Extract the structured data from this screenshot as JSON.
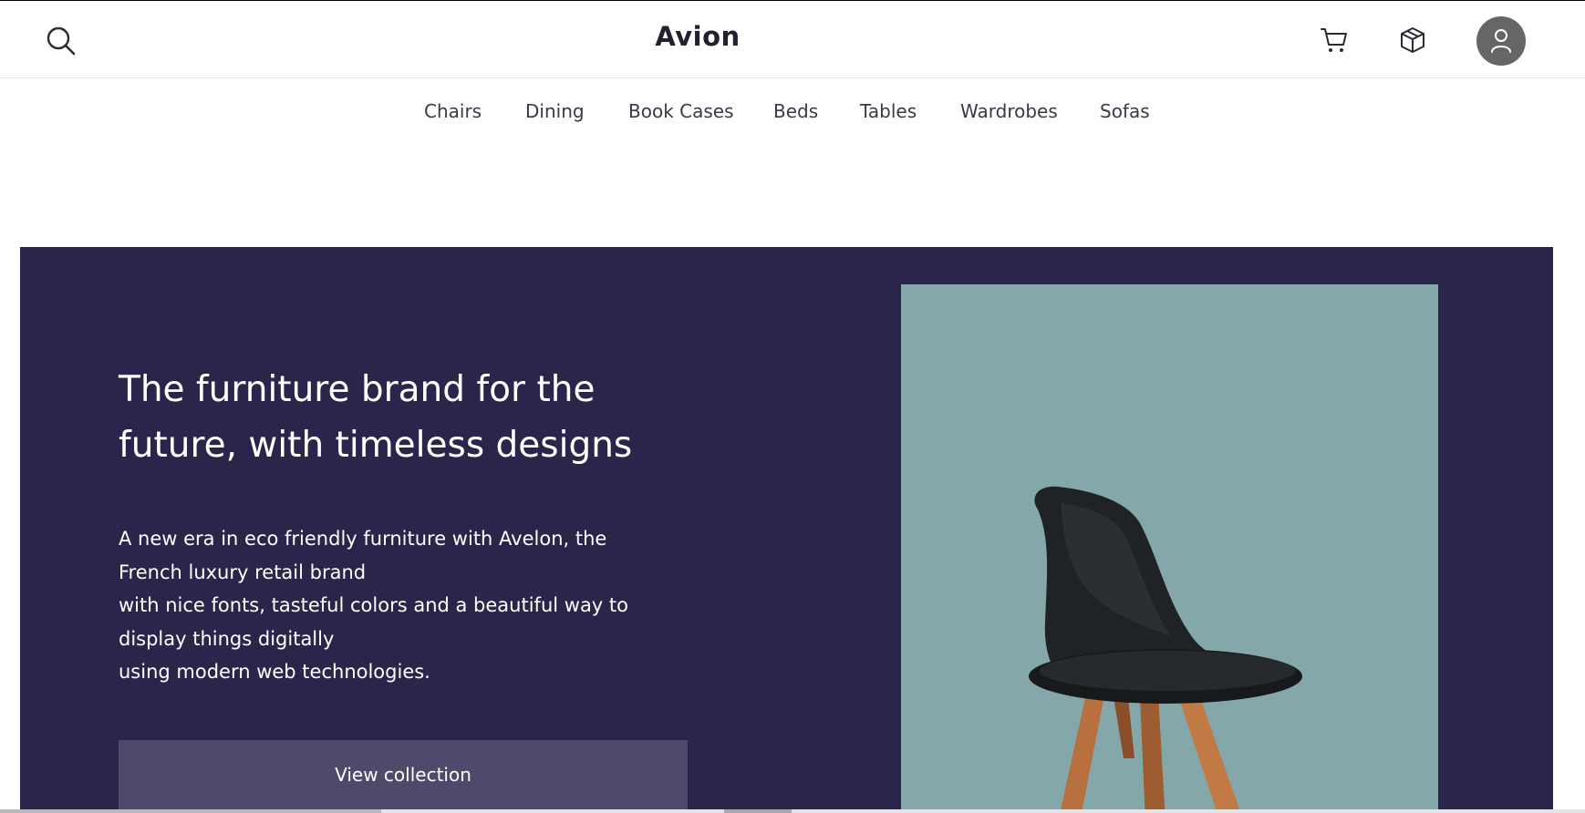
{
  "header": {
    "brand": "Avion",
    "icons": {
      "search": "search-icon",
      "cart": "cart-icon",
      "box": "box-icon",
      "user": "user-icon"
    }
  },
  "nav": {
    "items": [
      {
        "label": "Chairs"
      },
      {
        "label": "Dining"
      },
      {
        "label": "Book Cases"
      },
      {
        "label": "Beds"
      },
      {
        "label": "Tables"
      },
      {
        "label": "Wardrobes"
      },
      {
        "label": "Sofas"
      }
    ]
  },
  "hero": {
    "title_lines": [
      "The furniture brand for the",
      "future, with timeless designs"
    ],
    "description_lines": [
      "A new era in eco friendly furniture with Avelon, the",
      "French luxury retail brand",
      "with nice fonts, tasteful colors and a beautiful way to",
      "display things digitally",
      "using modern web technologies."
    ],
    "cta_label": "View collection",
    "image_subject": "black-chair"
  },
  "colors": {
    "primary": "#2a254b",
    "button": "#4f4a6b",
    "image_background": "#84a8aa",
    "avatar": "#666666"
  }
}
